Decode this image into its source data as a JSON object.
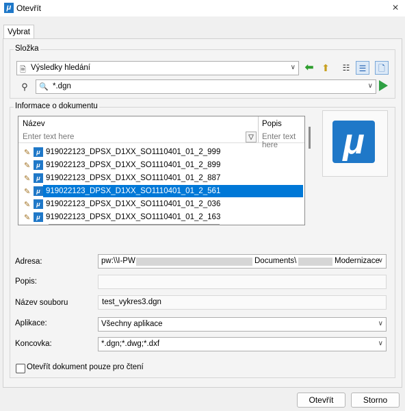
{
  "window": {
    "title": "Otevřít",
    "close_icon": "×"
  },
  "tab": {
    "label": "Vybrat"
  },
  "folder": {
    "group_label": "Složka",
    "selected": "Výsledky hledání",
    "filter": "*.dgn"
  },
  "doc_info": {
    "group_label": "Informace o dokumentu",
    "columns": {
      "name": "Název",
      "desc": "Popis"
    },
    "filter_placeholder": "Enter text here",
    "rows": [
      "919022123_DPSX_D1XX_SO1110401_01_2_999",
      "919022123_DPSX_D1XX_SO1110401_01_2_899",
      "919022123_DPSX_D1XX_SO1110401_01_2_887",
      "919022123_DPSX_D1XX_SO1110401_01_2_561",
      "919022123_DPSX_D1XX_SO1110401_01_2_036",
      "919022123_DPSX_D1XX_SO1110401_01_2_163"
    ],
    "selected_index": 3
  },
  "form": {
    "address_label": "Adresa:",
    "address_prefix": "pw:\\\\I-PW",
    "address_mid": "Documents\\",
    "address_suffix": "Modernizace",
    "desc_label": "Popis:",
    "desc_value": "",
    "filename_label": "Název souboru",
    "filename_value": "test_vykres3.dgn",
    "app_label": "Aplikace:",
    "app_value": "Všechny aplikace",
    "ext_label": "Koncovka:",
    "ext_value": "*.dgn;*.dwg;*.dxf",
    "readonly_label": "Otevřít dokument pouze pro čtení",
    "readonly_checked": false
  },
  "buttons": {
    "open": "Otevřít",
    "cancel": "Storno"
  }
}
